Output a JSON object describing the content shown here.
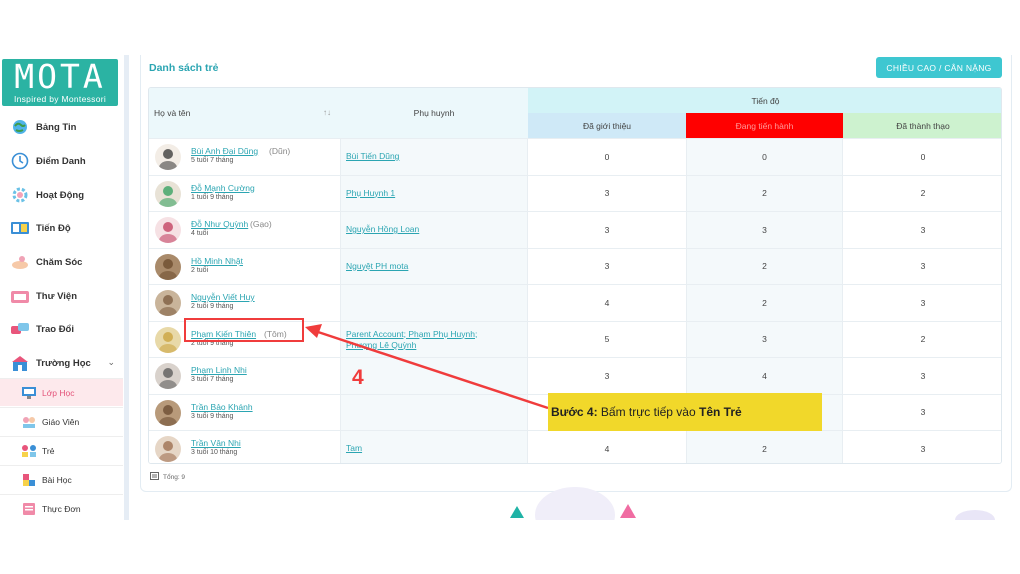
{
  "brand": {
    "logo_text": "MOTA",
    "tagline": "Inspired by Montessori"
  },
  "sidebar": {
    "items": [
      {
        "label": "Bảng Tin",
        "icon": "globe-icon"
      },
      {
        "label": "Điểm Danh",
        "icon": "clock-icon"
      },
      {
        "label": "Hoạt Động",
        "icon": "gear-icon"
      },
      {
        "label": "Tiến Độ",
        "icon": "book-icon"
      },
      {
        "label": "Chăm Sóc",
        "icon": "care-icon"
      },
      {
        "label": "Thư Viện",
        "icon": "library-icon"
      },
      {
        "label": "Trao Đổi",
        "icon": "chat-icon"
      },
      {
        "label": "Trường Học",
        "icon": "school-icon",
        "expanded": true
      }
    ],
    "sub_items": [
      {
        "label": "Lớp Học",
        "icon": "classroom-icon",
        "active": true
      },
      {
        "label": "Giáo Viên",
        "icon": "teacher-icon"
      },
      {
        "label": "Trẻ",
        "icon": "children-icon"
      },
      {
        "label": "Bài Học",
        "icon": "lesson-icon"
      },
      {
        "label": "Thực Đơn",
        "icon": "menu-icon"
      }
    ]
  },
  "page": {
    "title": "Danh sách trẻ",
    "height_weight_button": "CHIỀU CAO / CÂN NẶNG",
    "total_label": "Tổng: 9"
  },
  "table": {
    "headers": {
      "name": "Họ và tên",
      "parent": "Phụ huynh",
      "progress": "Tiến độ",
      "introduced": "Đã giới thiệu",
      "in_progress": "Đang tiến hành",
      "mastered": "Đã thành thạo"
    },
    "rows": [
      {
        "name": "Bùi Anh Đại Dũng",
        "nickname": "(Dũn)",
        "age": "5 tuổi 7 tháng",
        "parent": "Bùi Tiến Dũng",
        "introduced": "0",
        "in_progress": "0",
        "mastered": "0"
      },
      {
        "name": "Đỗ Mạnh Cường",
        "nickname": "",
        "age": "1 tuổi 9 tháng",
        "parent": "Phụ Huynh 1",
        "introduced": "3",
        "in_progress": "2",
        "mastered": "2"
      },
      {
        "name": "Đỗ Như Quỳnh",
        "nickname": "(Gạo)",
        "age": "4 tuổi",
        "parent": "Nguyễn Hồng Loan",
        "introduced": "3",
        "in_progress": "3",
        "mastered": "3"
      },
      {
        "name": "Hồ Minh Nhật",
        "nickname": "",
        "age": "2 tuổi",
        "parent": "Nguyệt PH mota",
        "introduced": "3",
        "in_progress": "2",
        "mastered": "3"
      },
      {
        "name": "Nguyễn Viết Huy",
        "nickname": "",
        "age": "2 tuổi 9 tháng",
        "parent": "",
        "introduced": "4",
        "in_progress": "2",
        "mastered": "3"
      },
      {
        "name": "Phạm Kiến Thiên",
        "nickname": "(Tôm)",
        "age": "2 tuổi 9 tháng",
        "parent": "Parent Account;  Phạm Phụ Huynh;",
        "parent_line2": "Phượng Lê Quỳnh",
        "introduced": "5",
        "in_progress": "3",
        "mastered": "2"
      },
      {
        "name": "Phạm Linh Nhi",
        "nickname": "",
        "age": "3 tuổi 7 tháng",
        "parent": "",
        "introduced": "3",
        "in_progress": "4",
        "mastered": "3"
      },
      {
        "name": "Trần Bảo Khánh",
        "nickname": "",
        "age": "3 tuổi 9 tháng",
        "parent": "",
        "introduced": "",
        "in_progress": "",
        "mastered": "3"
      },
      {
        "name": "Trần Vân Nhi",
        "nickname": "",
        "age": "3 tuổi 10 tháng",
        "parent": "Tam",
        "introduced": "4",
        "in_progress": "2",
        "mastered": "3"
      }
    ]
  },
  "annotation": {
    "step_number": "4",
    "callout_prefix": "Bước 4:",
    "callout_text": " Bấm trực tiếp vào ",
    "callout_target": "Tên Trẻ",
    "color": "#f03c3c",
    "callout_bg": "#f1d82a"
  },
  "colors": {
    "accent": "#2ba5b2",
    "button": "#3ec7d1",
    "in_progress_header": "#ff0000"
  }
}
